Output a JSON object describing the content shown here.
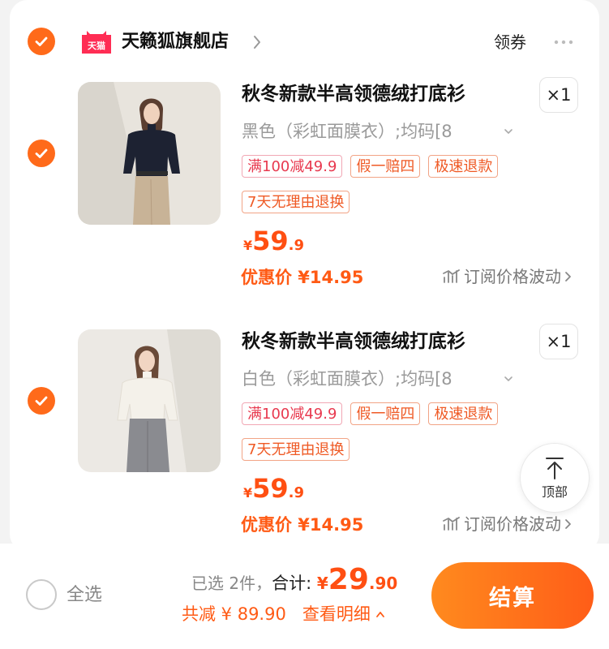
{
  "colors": {
    "accent": "#ff6a1a",
    "price": "#ff4f12",
    "tag_border": "#f2a486",
    "promo_tag": "#e8394f",
    "page_bg": "#f3f3f3"
  },
  "shop": {
    "logo_text": "天猫",
    "name": "天籁狐旗舰店",
    "coupon_label": "领券",
    "icons": [
      "check-icon",
      "tmall-logo",
      "chevron-right-icon",
      "more-icon"
    ]
  },
  "items": [
    {
      "title": "秋冬新款半高领德绒打底衫",
      "quantity": "×1",
      "sku": "黑色（彩虹面膜衣）;均码[8",
      "tags": [
        "满100减49.9",
        "假一赔四",
        "极速退款",
        "7天无理由退换"
      ],
      "price_symbol": "¥",
      "price_integer": "59",
      "price_decimal": ".9",
      "discount_label": "优惠价 ¥14.95",
      "subscribe_label": "订阅价格波动"
    },
    {
      "title": "秋冬新款半高领德绒打底衫",
      "quantity": "×1",
      "sku": "白色（彩虹面膜衣）;均码[8",
      "tags": [
        "满100减49.9",
        "假一赔四",
        "极速退款",
        "7天无理由退换"
      ],
      "price_symbol": "¥",
      "price_integer": "59",
      "price_decimal": ".9",
      "discount_label": "优惠价 ¥14.95",
      "subscribe_label": "订阅价格波动"
    }
  ],
  "back_to_top": {
    "label": "顶部",
    "icon": "arrow-up-icon"
  },
  "bottom_bar": {
    "select_all_label": "全选",
    "selected_text": "已选 2件，",
    "total_label": "合计: ",
    "total_symbol": "¥",
    "total_integer": "29",
    "total_decimal": ".90",
    "saving_text": "共减 ¥ 89.90",
    "detail_label": "查看明细",
    "checkout_label": "结算"
  }
}
